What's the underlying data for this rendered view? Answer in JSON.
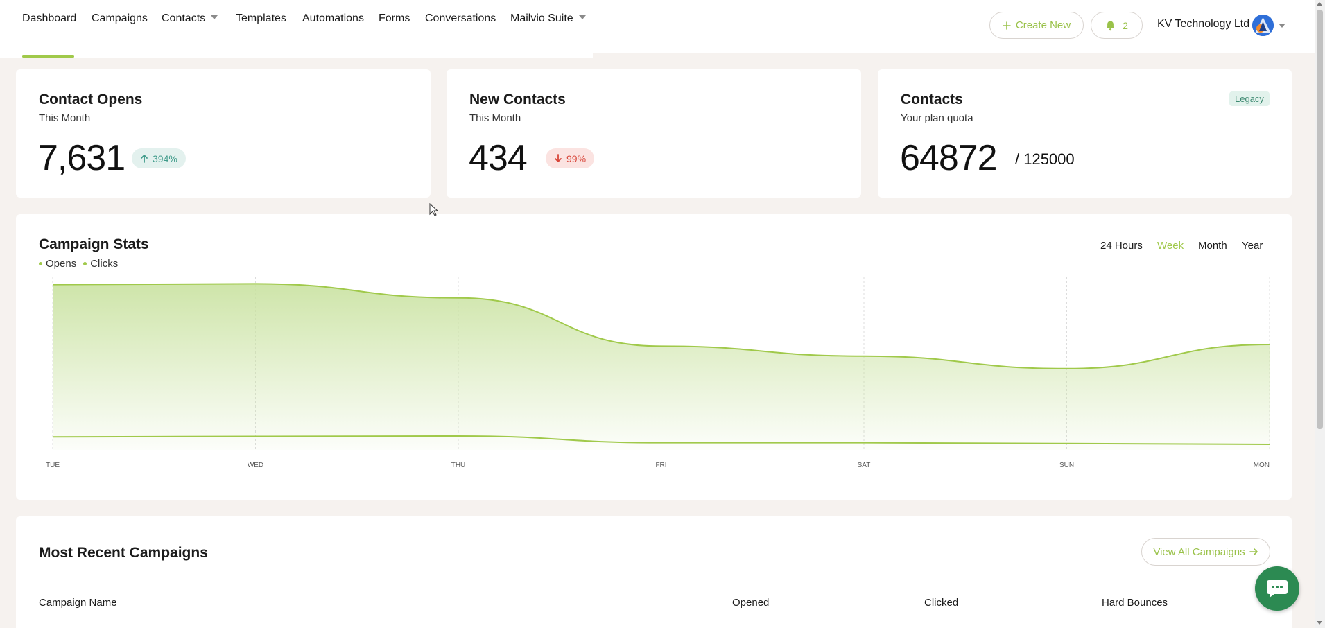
{
  "nav": {
    "items": [
      {
        "label": "Dashboard",
        "active": true
      },
      {
        "label": "Campaigns"
      },
      {
        "label": "Contacts",
        "dropdown": true
      },
      {
        "label": "Templates"
      },
      {
        "label": "Automations"
      },
      {
        "label": "Forms"
      },
      {
        "label": "Conversations"
      },
      {
        "label": "Mailvio Suite",
        "dropdown": true
      }
    ]
  },
  "header": {
    "create_label": "Create New",
    "notifications_count": "2",
    "org_name": "KV Technology Ltd"
  },
  "stats": {
    "opens": {
      "title": "Contact Opens",
      "subtitle": "This Month",
      "value": "7,631",
      "change": "394%",
      "direction": "up"
    },
    "new_contacts": {
      "title": "New Contacts",
      "subtitle": "This Month",
      "value": "434",
      "change": "99%",
      "direction": "down"
    },
    "contacts": {
      "title": "Contacts",
      "subtitle": "Your plan quota",
      "value": "64872",
      "quota": "/ 125000",
      "badge": "Legacy"
    }
  },
  "campaign_stats": {
    "title": "Campaign Stats",
    "ranges": [
      "24 Hours",
      "Week",
      "Month",
      "Year"
    ],
    "active_range": "Week"
  },
  "chart_data": {
    "type": "area",
    "categories": [
      "TUE",
      "WED",
      "THU",
      "FRI",
      "SAT",
      "SUN",
      "MON"
    ],
    "series": [
      {
        "name": "Opens",
        "values": [
          960,
          965,
          880,
          590,
          530,
          455,
          600
        ]
      },
      {
        "name": "Clicks",
        "values": [
          45,
          48,
          50,
          10,
          10,
          5,
          0
        ]
      }
    ],
    "ylim": [
      0,
      1000
    ],
    "grid": true,
    "legend": "top-left",
    "colors": {
      "line": "#a0c94a",
      "fill": "#c9e2a0"
    }
  },
  "recent": {
    "title": "Most Recent Campaigns",
    "view_all_label": "View All Campaigns",
    "columns": [
      "Campaign Name",
      "Opened",
      "Clicked",
      "Hard Bounces"
    ]
  },
  "colors": {
    "accent": "#a0c94a",
    "up": "#3f9b8a",
    "down": "#d8463a",
    "chat": "#2c8a52"
  }
}
